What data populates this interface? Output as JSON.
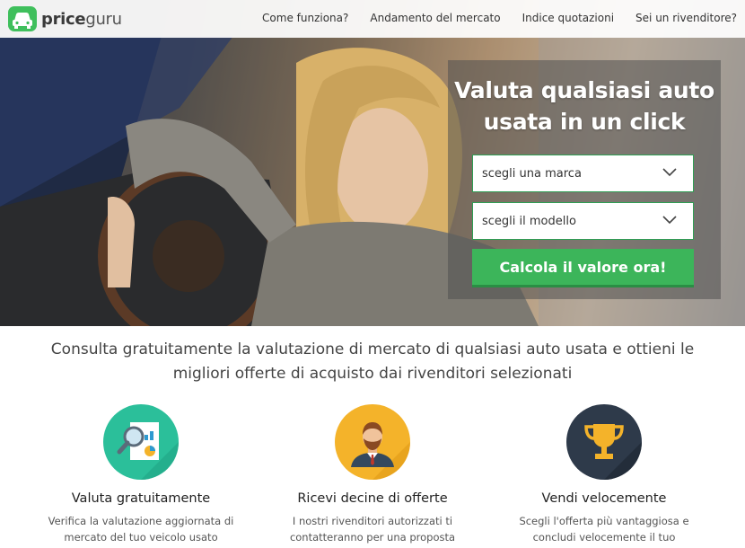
{
  "brand": {
    "name_bold": "price",
    "name_light": "guru",
    "logo_icon": "car-front-icon",
    "accent_color": "#3fbf5c"
  },
  "nav": {
    "items": [
      {
        "label": "Come funziona?"
      },
      {
        "label": "Andamento del mercato"
      },
      {
        "label": "Indice quotazioni"
      },
      {
        "label": "Sei un rivenditore?"
      }
    ]
  },
  "hero": {
    "title": "Valuta qualsiasi auto usata in un click",
    "brand_select": {
      "value": "scegli una marca",
      "icon": "chevron-down-icon"
    },
    "model_select": {
      "value": "scegli il modello",
      "icon": "chevron-down-icon"
    },
    "cta_label": "Calcola il valore ora!",
    "cta_color": "#3cb55a"
  },
  "intro": {
    "text": "Consulta gratuitamente la valutazione di mercato di qualsiasi auto usata e ottieni le migliori offerte di acquisto dai rivenditori selezionati"
  },
  "features": [
    {
      "title": "Valuta gratuitamente",
      "description": "Verifica la valutazione aggiornata di mercato del tuo veicolo usato",
      "icon": "magnifier-chart-icon",
      "color": "#2bbf9a"
    },
    {
      "title": "Ricevi decine di offerte",
      "description": "I nostri rivenditori autorizzati ti contatteranno per una proposta",
      "icon": "businessman-icon",
      "color": "#f4b32a"
    },
    {
      "title": "Vendi velocemente",
      "description": "Scegli l'offerta più vantaggiosa e concludi velocemente il tuo",
      "icon": "trophy-icon",
      "color": "#2e3a4a"
    }
  ]
}
